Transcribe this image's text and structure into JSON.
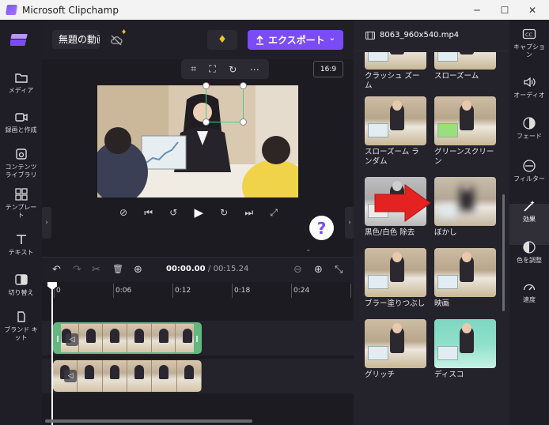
{
  "window": {
    "title": "Microsoft Clipchamp",
    "minimize": "─",
    "maximize": "☐",
    "close": "✕"
  },
  "sidebar": {
    "items": [
      {
        "label": "メディア",
        "icon": "folder-icon"
      },
      {
        "label": "録画と作成",
        "icon": "camera-icon"
      },
      {
        "label": "コンテンツ ライブラリ",
        "icon": "library-icon"
      },
      {
        "label": "テンプレート",
        "icon": "template-icon"
      },
      {
        "label": "テキスト",
        "icon": "text-icon"
      },
      {
        "label": "切り替え",
        "icon": "transition-icon"
      },
      {
        "label": "ブランド キット",
        "icon": "brand-kit-icon"
      }
    ]
  },
  "topbar": {
    "project_name": "無題の動画",
    "export_label": "エクスポート",
    "export_caret": "⌄",
    "gem": "♦",
    "premium": "♦"
  },
  "preview": {
    "toolbar": [
      "⌗",
      "⛶",
      "↻",
      "⋯"
    ],
    "aspect_ratio": "16:9",
    "controls": [
      "⊘",
      "⏮",
      "↺",
      "▶",
      "↻",
      "⏭",
      "⤢"
    ],
    "help": "?",
    "collapse": "⌄",
    "left_tab": "›",
    "right_tab": "›"
  },
  "timeline": {
    "tools": [
      "↶",
      "↷",
      "✂",
      "🗑",
      "⊕"
    ],
    "current_time": "00:00.00",
    "duration": "/ 00:15.24",
    "zoom": [
      "⊖",
      "⊕",
      "⤡"
    ],
    "ticks": [
      "0",
      "0:06",
      "0:12",
      "0:18",
      "0:24"
    ],
    "clip_mute": "◁"
  },
  "panel": {
    "file_name": "8063_960x540.mp4",
    "effects": [
      {
        "label": "クラッシュ ズーム",
        "style": "normal"
      },
      {
        "label": "スローズーム",
        "style": "normal"
      },
      {
        "label": "スローズーム ランダム",
        "style": "normal"
      },
      {
        "label": "グリーンスクリーン",
        "style": "green"
      },
      {
        "label": "黒色/白色 除去",
        "style": "gray"
      },
      {
        "label": "ぼかし",
        "style": "blur"
      },
      {
        "label": "ブラー塗りつぶし",
        "style": "normal"
      },
      {
        "label": "映画",
        "style": "normal"
      },
      {
        "label": "グリッチ",
        "style": "normal"
      },
      {
        "label": "ディスコ",
        "style": "disco"
      }
    ]
  },
  "rail": {
    "items": [
      {
        "label": "キャプション",
        "icon": "captions-icon"
      },
      {
        "label": "オーディオ",
        "icon": "audio-icon"
      },
      {
        "label": "フェード",
        "icon": "fade-icon"
      },
      {
        "label": "フィルター",
        "icon": "filter-icon"
      },
      {
        "label": "効果",
        "icon": "effects-icon",
        "active": true
      },
      {
        "label": "色を調整",
        "icon": "color-adjust-icon"
      },
      {
        "label": "速度",
        "icon": "speed-icon"
      }
    ]
  },
  "colors": {
    "accent": "#7a4cf5",
    "selection": "#3fd18d",
    "arrow": "#e52222"
  }
}
